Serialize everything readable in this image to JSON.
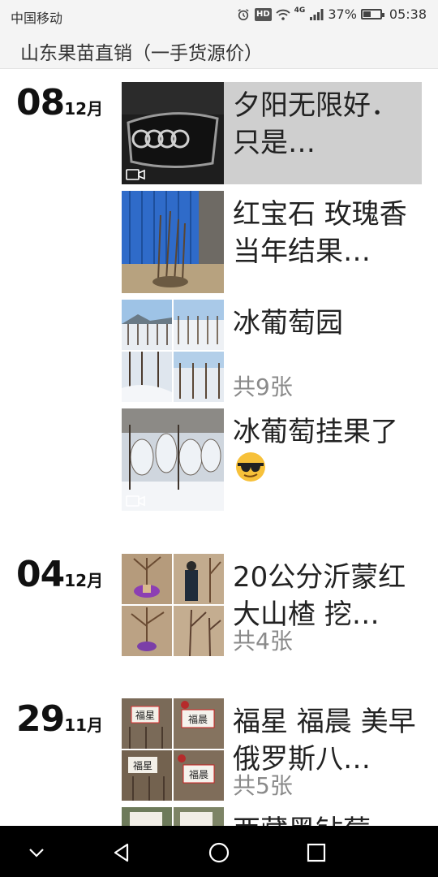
{
  "status_bar": {
    "carrier": "中国移动",
    "network": "4G",
    "battery": "37%",
    "time": "05:38"
  },
  "header": {
    "title": "山东果苗直销（一手货源价）"
  },
  "days": [
    {
      "day": "08",
      "month": "12月",
      "posts": [
        {
          "text": "夕阳无限好．只是…",
          "media": "video",
          "highlighted": true
        },
        {
          "text": "红宝石 玫瑰香 当年结果…",
          "media": "photo"
        },
        {
          "text": "冰葡萄园",
          "media": "album",
          "count": "共9张"
        },
        {
          "text": "冰葡萄挂果了",
          "media": "video",
          "emoji": "sunglasses-emoji"
        }
      ]
    },
    {
      "day": "04",
      "month": "12月",
      "posts": [
        {
          "text": "20公分沂蒙红大山楂 挖…",
          "media": "album",
          "count": "共4张"
        }
      ]
    },
    {
      "day": "29",
      "month": "11月",
      "posts": [
        {
          "text": "福星 福晨 美早 俄罗斯八…",
          "media": "album",
          "count": "共5张",
          "sign_texts": [
            "福星",
            "福晨",
            "福星",
            "福晨"
          ]
        },
        {
          "text": "西藏黑钻莓",
          "media": "album"
        }
      ]
    }
  ]
}
